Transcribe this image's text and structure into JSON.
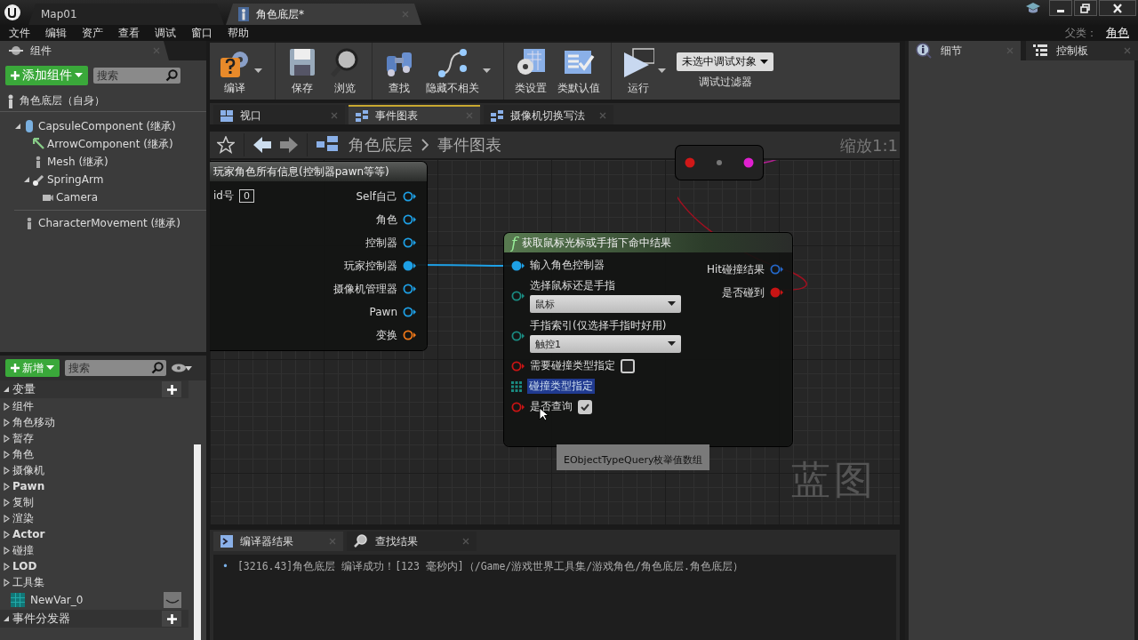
{
  "title_bar": {
    "tabs": [
      {
        "label": "Map01",
        "selected": false,
        "closable": false
      },
      {
        "label": "角色底层*",
        "selected": true,
        "closable": true
      }
    ]
  },
  "menu": [
    "文件",
    "编辑",
    "资产",
    "查看",
    "调试",
    "窗口",
    "帮助"
  ],
  "parent_class": {
    "label": "父类：",
    "value": "角色"
  },
  "components": {
    "tab": "组件",
    "add_button": "添加组件",
    "search": {
      "placeholder": "搜索"
    },
    "root": "角色底层（自身）",
    "tree": [
      {
        "kind": "capsule",
        "label": "CapsuleComponent (继承)",
        "expanded": true,
        "children": [
          {
            "kind": "arrow",
            "label": "ArrowComponent (继承)"
          },
          {
            "kind": "mesh",
            "label": "Mesh (继承)"
          },
          {
            "kind": "spring",
            "label": "SpringArm",
            "expanded": true,
            "children": [
              {
                "kind": "camera",
                "label": "Camera"
              }
            ]
          }
        ]
      },
      {
        "kind": "movement",
        "label": "CharacterMovement (继承)"
      }
    ]
  },
  "my_blueprint": {
    "new_button": "新增",
    "search": {
      "placeholder": "搜索"
    },
    "sections": [
      {
        "label": "变量",
        "expanded": true,
        "items": [
          {
            "kind": "category",
            "label": "组件",
            "expanded": false
          },
          {
            "kind": "category",
            "label": "角色移动",
            "expanded": false
          },
          {
            "kind": "category",
            "label": "暂存",
            "expanded": false
          },
          {
            "kind": "category",
            "label": "角色",
            "expanded": false
          },
          {
            "kind": "category",
            "label": "摄像机",
            "expanded": false
          },
          {
            "kind": "category",
            "label": "Pawn",
            "expanded": false
          },
          {
            "kind": "category",
            "label": "复制",
            "expanded": false
          },
          {
            "kind": "category",
            "label": "渲染",
            "expanded": false
          },
          {
            "kind": "category",
            "label": "Actor",
            "expanded": false
          },
          {
            "kind": "category",
            "label": "碰撞",
            "expanded": false
          },
          {
            "kind": "category",
            "label": "LOD",
            "expanded": false
          },
          {
            "kind": "category",
            "label": "工具集",
            "expanded": false
          },
          {
            "kind": "variable",
            "label": "NewVar_0"
          }
        ]
      },
      {
        "label": "事件分发器",
        "expanded": true
      }
    ]
  },
  "toolbar": {
    "buttons": [
      {
        "kind": "compile",
        "label": "编译",
        "menu": true
      },
      {
        "kind": "save",
        "label": "保存",
        "menu": false
      },
      {
        "kind": "browse",
        "label": "浏览",
        "menu": false
      },
      {
        "kind": "find",
        "label": "查找",
        "menu": false
      },
      {
        "kind": "hide",
        "label": "隐藏不相关",
        "menu": true
      },
      {
        "kind": "class_settings",
        "label": "类设置",
        "menu": false
      },
      {
        "kind": "class_defaults",
        "label": "类默认值",
        "menu": false
      },
      {
        "kind": "play",
        "label": "运行",
        "menu": true
      }
    ],
    "debug_filter": {
      "value": "未选中调试对象",
      "label": "调试过滤器"
    }
  },
  "document_tabs": [
    {
      "kind": "viewport",
      "label": "视口",
      "selected": false
    },
    {
      "kind": "graph",
      "label": "事件图表",
      "selected": true
    },
    {
      "kind": "graph",
      "label": "摄像机切换写法",
      "selected": false
    }
  ],
  "graph": {
    "breadcrumb": [
      "角色底层",
      "事件图表"
    ],
    "zoom": "缩放1:1",
    "watermark": "蓝图",
    "tooltip": "EObjectTypeQuery枚举值数组",
    "nodes": [
      {
        "kind": "pure",
        "title": "玩家角色所有信息(控制器pawn等等)",
        "inputs": [
          {
            "kind": "value",
            "label": "id号",
            "value": "0"
          }
        ],
        "outputs": [
          {
            "label": "Self自己",
            "color": "#1ea0e6",
            "connected": false
          },
          {
            "label": "角色",
            "color": "#1ea0e6",
            "connected": false
          },
          {
            "label": "控制器",
            "color": "#1ea0e6",
            "connected": false
          },
          {
            "label": "玩家控制器",
            "color": "#1ea0e6",
            "connected": true
          },
          {
            "label": "摄像机管理器",
            "color": "#1ea0e6",
            "connected": false
          },
          {
            "label": "Pawn",
            "color": "#1ea0e6",
            "connected": false
          },
          {
            "label": "变换",
            "color": "#f07818",
            "connected": false
          }
        ]
      },
      {
        "kind": "function",
        "glyph": "f",
        "title": "获取鼠标光标或手指下命中结果",
        "inputs": [
          {
            "kind": "pin",
            "label": "输入角色控制器",
            "color": "#1ea0e6",
            "connected": true
          },
          {
            "kind": "dropdown",
            "label": "选择鼠标还是手指",
            "value": "鼠标",
            "color": "#1a8a80",
            "connected": false
          },
          {
            "kind": "dropdown",
            "label": "手指索引(仅选择手指时好用)",
            "value": "触控1",
            "color": "#1a8a80",
            "connected": false
          },
          {
            "kind": "checkbox",
            "label": "需要碰撞类型指定",
            "checked": false,
            "color": "#c81414",
            "connected": false
          },
          {
            "kind": "array",
            "label": "碰撞类型指定",
            "highlighted": true,
            "color": "#1a8a80"
          },
          {
            "kind": "checkbox",
            "label": "是否查询",
            "checked": true,
            "color": "#c81414",
            "connected": false
          }
        ],
        "outputs": [
          {
            "label": "Hit碰撞结果",
            "color": "#2468c8",
            "connected": false
          },
          {
            "label": "是否碰到",
            "color": "#c81414",
            "connected": true
          }
        ]
      },
      {
        "kind": "reroute",
        "pins": [
          {
            "color": "#d01818"
          },
          {
            "color": "#e020d0"
          }
        ]
      }
    ]
  },
  "output": {
    "tabs": [
      {
        "kind": "compiler",
        "label": "编译器结果",
        "selected": true
      },
      {
        "kind": "find",
        "label": "查找结果",
        "selected": false
      }
    ],
    "log": [
      {
        "bullet": "•",
        "text": "[3216.43]角色底层 编译成功！[123 毫秒内]（/Game/游戏世界工具集/游戏角色/角色底层.角色底层）"
      }
    ]
  },
  "details": {
    "tabs": [
      {
        "kind": "details",
        "label": "细节",
        "selected": true
      },
      {
        "kind": "palette",
        "label": "控制板",
        "selected": false
      }
    ]
  }
}
